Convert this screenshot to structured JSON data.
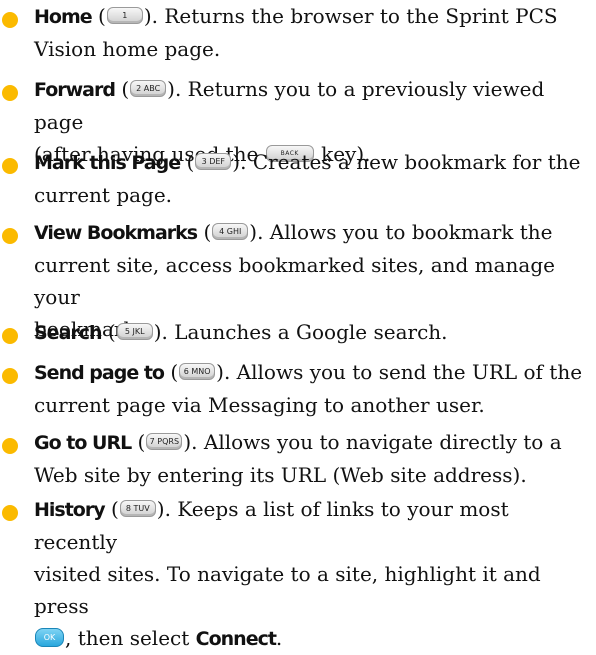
{
  "items": [
    {
      "term": "Home",
      "key": "1",
      "lines": [
        "). Returns the browser to the Sprint PCS",
        "Vision home page."
      ]
    },
    {
      "term": "Forward",
      "key": "2 ABC",
      "lines": [
        "). Returns you to a previously viewed page",
        "(after having used the",
        "key)."
      ],
      "inline_key": "BACK"
    },
    {
      "term": "Mark this Page",
      "key": "3 DEF",
      "lines": [
        "). Creates a new bookmark for the",
        "current page."
      ]
    },
    {
      "term": "View Bookmarks",
      "key": "4 GHI",
      "lines": [
        "). Allows you to bookmark the",
        "current site, access bookmarked sites, and manage your",
        "bookmarks."
      ]
    },
    {
      "term": "Search",
      "key": "5 JKL",
      "lines": [
        "). Launches a Google search."
      ]
    },
    {
      "term": "Send page to",
      "key": "6 MNO",
      "lines": [
        "). Allows you to send the URL of the",
        "current page via Messaging to another user."
      ]
    },
    {
      "term": "Go to URL",
      "key": "7 PQRS",
      "lines": [
        "). Allows you to navigate directly to a",
        "Web site by entering its URL (Web site address)."
      ]
    },
    {
      "term": "History",
      "key": "8 TUV",
      "lines": [
        "). Keeps a list of links to your most recently",
        "visited sites. To navigate to a site, highlight it and press",
        ", then select",
        "Connect",
        "."
      ],
      "ok_key": "OK"
    }
  ]
}
